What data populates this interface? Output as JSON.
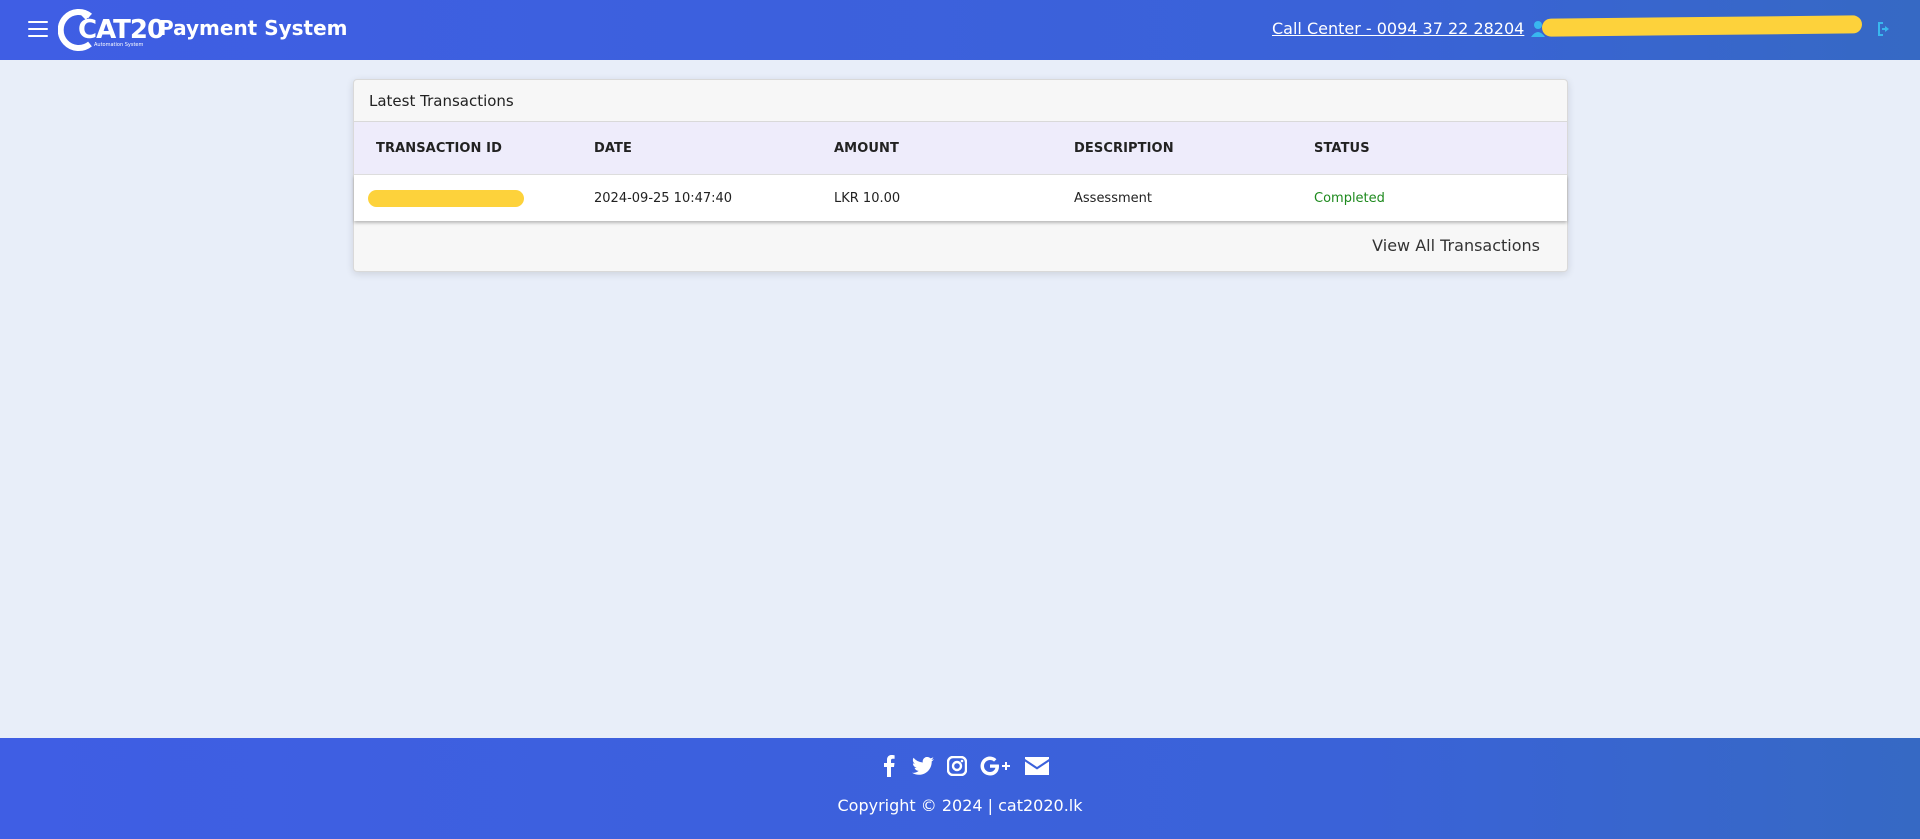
{
  "header": {
    "title": "Payment System",
    "logo_text": "CAT20",
    "logo_sub": "Automation System",
    "call_center": "Call Center - 0094 37 22 28204",
    "user_name": "",
    "accent_link_color": "#39b7ef",
    "gradient_start": "#3f5ee4",
    "gradient_end": "#3669c4"
  },
  "transactions": {
    "card_title": "Latest Transactions",
    "columns": [
      "TRANSACTION ID",
      "DATE",
      "AMOUNT",
      "DESCRIPTION",
      "STATUS"
    ],
    "rows": [
      {
        "transaction_id": "",
        "date": "2024-09-25 10:47:40",
        "amount": "LKR 10.00",
        "description": "Assessment",
        "status": "Completed",
        "status_color": "#1e8a1e"
      }
    ],
    "view_all": "View All Transactions"
  },
  "footer": {
    "social_icons": [
      "facebook-icon",
      "twitter-icon",
      "instagram-icon",
      "google-plus-icon",
      "email-icon"
    ],
    "copyright": "Copyright © 2024 | cat2020.lk"
  }
}
